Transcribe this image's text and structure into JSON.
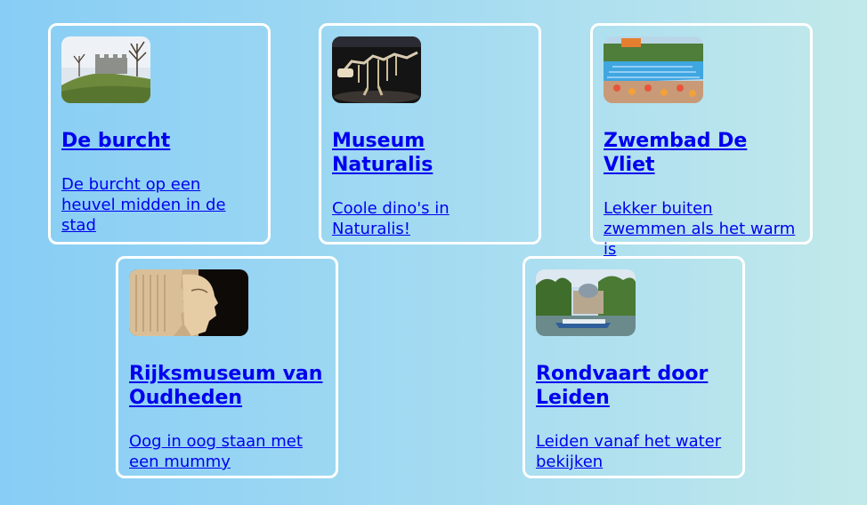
{
  "cards": [
    {
      "title": "De burcht",
      "description": "De burcht op een heuvel midden in de stad",
      "image": "castle-on-hill-photo"
    },
    {
      "title": "Museum Naturalis",
      "description": "Coole dino's in Naturalis!",
      "image": "dinosaur-skeleton-photo"
    },
    {
      "title": "Zwembad De Vliet",
      "description": "Lekker buiten zwemmen als het warm is",
      "image": "outdoor-pool-photo"
    },
    {
      "title": "Rijksmuseum van Oudheden",
      "description": "Oog in oog staan met een mummy",
      "image": "egyptian-statue-photo"
    },
    {
      "title": "Rondvaart door Leiden",
      "description": "Leiden vanaf het water bekijken",
      "image": "canal-boat-photo"
    }
  ],
  "colors": {
    "link": "#0000ee",
    "card_border": "#ffffff",
    "background_start": "#87cdf5",
    "background_end": "#c2e9ea"
  }
}
